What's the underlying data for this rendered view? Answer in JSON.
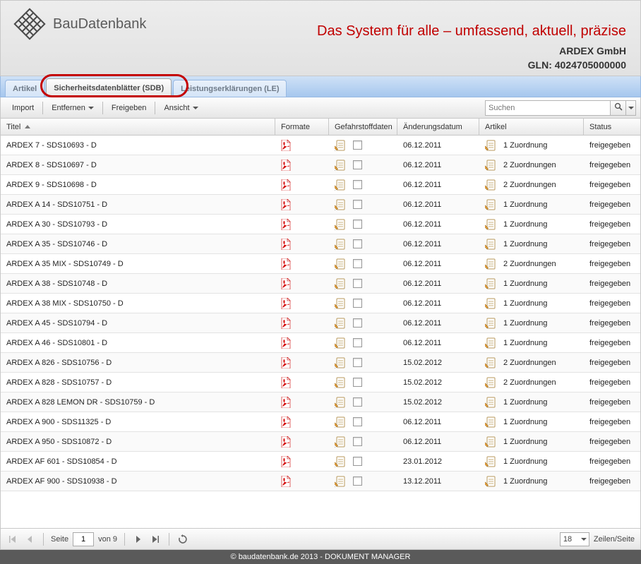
{
  "header": {
    "brand_prefix": "Bau",
    "brand_suffix": "Datenbank",
    "tagline": "Das System für alle – umfassend, aktuell, präzise",
    "company": "ARDEX GmbH",
    "gln_label": "GLN: 4024705000000"
  },
  "tabs": {
    "artikel": "Artikel",
    "sdb": "Sicherheitsdatenblätter (SDB)",
    "le": "Leistungserklärungen (LE)"
  },
  "toolbar": {
    "import": "Import",
    "entfernen": "Entfernen",
    "freigeben": "Freigeben",
    "ansicht": "Ansicht"
  },
  "search": {
    "placeholder": "Suchen"
  },
  "columns": {
    "titel": "Titel",
    "formate": "Formate",
    "gefahrstoffdaten": "Gefahrstoffdaten",
    "aenderungsdatum": "Änderungsdatum",
    "artikel": "Artikel",
    "status": "Status"
  },
  "rows": [
    {
      "title": "ARDEX 7 - SDS10693 - D",
      "date": "06.12.2011",
      "assign": "1 Zuordnung",
      "status": "freigegeben"
    },
    {
      "title": "ARDEX 8 - SDS10697 - D",
      "date": "06.12.2011",
      "assign": "2 Zuordnungen",
      "status": "freigegeben"
    },
    {
      "title": "ARDEX 9 - SDS10698 - D",
      "date": "06.12.2011",
      "assign": "2 Zuordnungen",
      "status": "freigegeben"
    },
    {
      "title": "ARDEX A 14 - SDS10751 - D",
      "date": "06.12.2011",
      "assign": "1 Zuordnung",
      "status": "freigegeben"
    },
    {
      "title": "ARDEX A 30 - SDS10793 - D",
      "date": "06.12.2011",
      "assign": "1 Zuordnung",
      "status": "freigegeben"
    },
    {
      "title": "ARDEX A 35 - SDS10746 - D",
      "date": "06.12.2011",
      "assign": "1 Zuordnung",
      "status": "freigegeben"
    },
    {
      "title": "ARDEX A 35 MIX - SDS10749 - D",
      "date": "06.12.2011",
      "assign": "2 Zuordnungen",
      "status": "freigegeben"
    },
    {
      "title": "ARDEX A 38 - SDS10748 - D",
      "date": "06.12.2011",
      "assign": "1 Zuordnung",
      "status": "freigegeben"
    },
    {
      "title": "ARDEX A 38 MIX - SDS10750 - D",
      "date": "06.12.2011",
      "assign": "1 Zuordnung",
      "status": "freigegeben"
    },
    {
      "title": "ARDEX A 45 - SDS10794 - D",
      "date": "06.12.2011",
      "assign": "1 Zuordnung",
      "status": "freigegeben"
    },
    {
      "title": "ARDEX A 46 - SDS10801 - D",
      "date": "06.12.2011",
      "assign": "1 Zuordnung",
      "status": "freigegeben"
    },
    {
      "title": "ARDEX A 826 - SDS10756 - D",
      "date": "15.02.2012",
      "assign": "2 Zuordnungen",
      "status": "freigegeben"
    },
    {
      "title": "ARDEX A 828 - SDS10757 - D",
      "date": "15.02.2012",
      "assign": "2 Zuordnungen",
      "status": "freigegeben"
    },
    {
      "title": "ARDEX A 828 LEMON DR - SDS10759 - D",
      "date": "15.02.2012",
      "assign": "1 Zuordnung",
      "status": "freigegeben"
    },
    {
      "title": "ARDEX A 900 - SDS11325 - D",
      "date": "06.12.2011",
      "assign": "1 Zuordnung",
      "status": "freigegeben"
    },
    {
      "title": "ARDEX A 950 - SDS10872 - D",
      "date": "06.12.2011",
      "assign": "1 Zuordnung",
      "status": "freigegeben"
    },
    {
      "title": "ARDEX AF 601 - SDS10854 - D",
      "date": "23.01.2012",
      "assign": "1 Zuordnung",
      "status": "freigegeben"
    },
    {
      "title": "ARDEX AF 900 - SDS10938 - D",
      "date": "13.12.2011",
      "assign": "1 Zuordnung",
      "status": "freigegeben"
    }
  ],
  "pager": {
    "seite_label": "Seite",
    "page": "1",
    "von_label": "von 9",
    "per_page": "18",
    "per_page_label": "Zeilen/Seite"
  },
  "footer": "© baudatenbank.de 2013 - DOKUMENT MANAGER"
}
